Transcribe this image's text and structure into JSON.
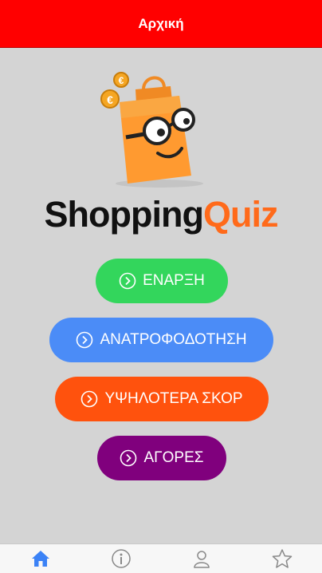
{
  "header": {
    "title": "Αρχική"
  },
  "logo": {
    "text_part1": "Shopping",
    "text_part2": "Quiz",
    "mascot_icon": "shopping-bag-mascot",
    "coin_symbol": "€"
  },
  "menu": {
    "start_label": "ΕΝΑΡΞΗ",
    "feedback_label": "ΑΝΑΤΡΟΦΟΔΟΤΗΣΗ",
    "scores_label": "ΥΨΗΛΟΤΕΡΑ ΣΚΟΡ",
    "purchases_label": "ΑΓΟΡΕΣ"
  },
  "colors": {
    "header": "#ff0000",
    "start": "#33d65c",
    "feedback": "#4b8cf7",
    "scores": "#ff520d",
    "purchases": "#80007d",
    "active_tab": "#3b82f6"
  },
  "tabs": [
    {
      "name": "home",
      "icon": "home-icon",
      "active": true
    },
    {
      "name": "info",
      "icon": "info-icon",
      "active": false
    },
    {
      "name": "profile",
      "icon": "user-icon",
      "active": false
    },
    {
      "name": "favorites",
      "icon": "star-icon",
      "active": false
    }
  ]
}
